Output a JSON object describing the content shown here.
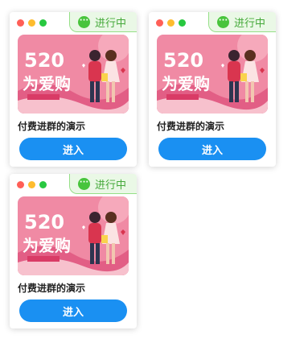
{
  "cards": [
    {
      "status": "进行中",
      "title": "付费进群的演示",
      "button": "进入",
      "poster_text": "520为爱购"
    },
    {
      "status": "进行中",
      "title": "付费进群的演示",
      "button": "进入",
      "poster_text": "520为爱购"
    },
    {
      "status": "进行中",
      "title": "付费进群的演示",
      "button": "进入",
      "poster_text": "520为爱购"
    }
  ],
  "colors": {
    "accent": "#1a90f2",
    "status_text": "#45a93a",
    "status_bg": "#eaf8e6",
    "poster_bg": "#f08aa4"
  },
  "icons": {
    "status": "chat-bubble-icon"
  }
}
